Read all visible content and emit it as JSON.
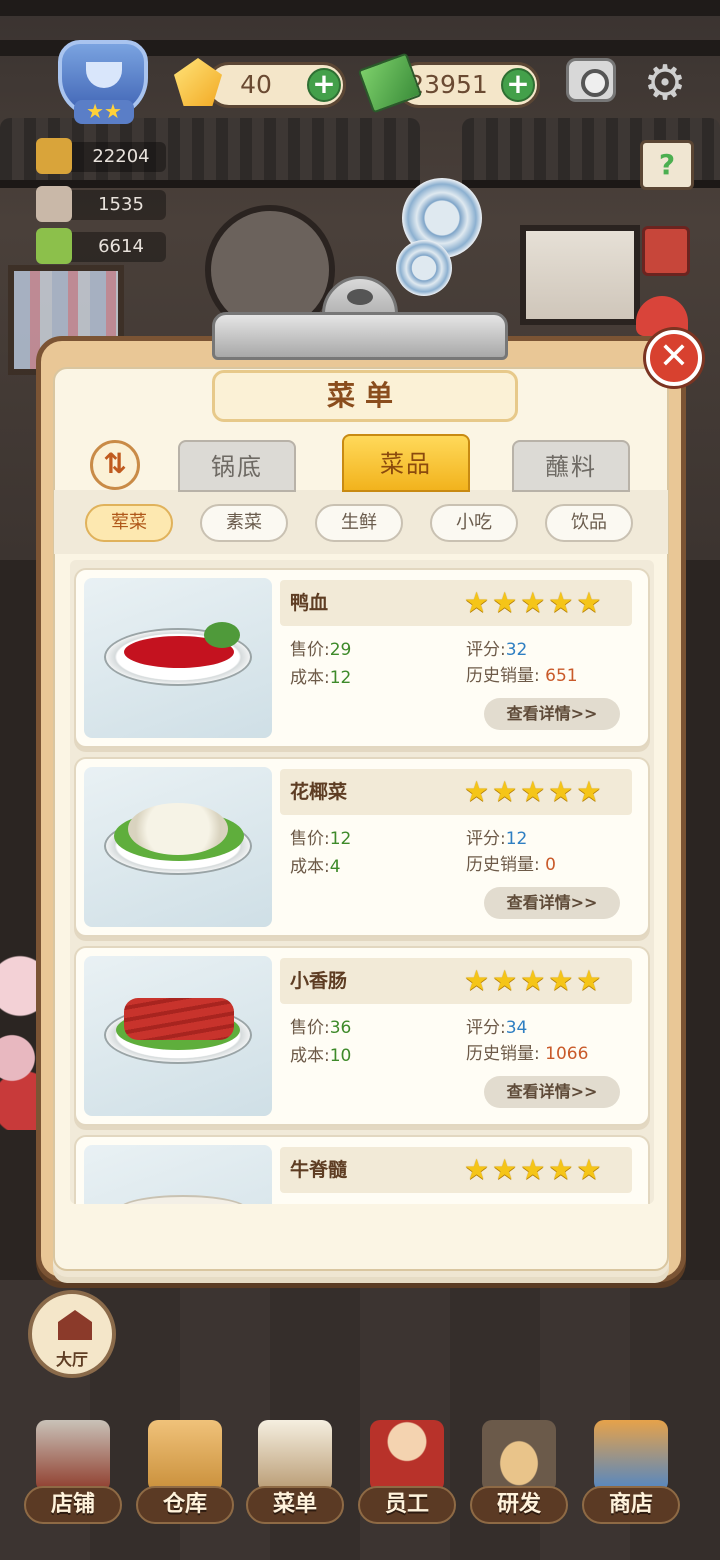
{
  "hud": {
    "gems": "40",
    "cash": "23951",
    "stat_pot": "22204",
    "stat_dish": "1535",
    "stat_ticket": "6614",
    "level_stars": "★★"
  },
  "menu": {
    "title": "菜单",
    "sort_icon": "⇅",
    "tabs": [
      "锅底",
      "菜品",
      "蘸料"
    ],
    "active_tab": 1,
    "categories": [
      "荤菜",
      "素菜",
      "生鲜",
      "小吃",
      "饮品"
    ],
    "active_category": 0,
    "labels": {
      "price": "售价:",
      "cost": "成本:",
      "rating": "评分:",
      "sales": "历史销量:",
      "detail": "查看详情>>"
    },
    "dishes": [
      {
        "name": "鸭血",
        "stars": 5,
        "price": "29",
        "cost": "12",
        "rating": "32",
        "sales": "651",
        "food": "duck-blood"
      },
      {
        "name": "花椰菜",
        "stars": 5,
        "price": "12",
        "cost": "4",
        "rating": "12",
        "sales": "0",
        "food": "cauliflower"
      },
      {
        "name": "小香肠",
        "stars": 5,
        "price": "36",
        "cost": "10",
        "rating": "34",
        "sales": "1066",
        "food": "sausage"
      },
      {
        "name": "牛脊髓",
        "stars": 5,
        "food": "beef-marrow"
      }
    ]
  },
  "hall_label": "大厅",
  "nav": [
    "店铺",
    "仓库",
    "菜单",
    "员工",
    "研发",
    "商店"
  ],
  "icons": {
    "close": "✕",
    "plus": "+",
    "gear": "⚙",
    "help": "?"
  },
  "colors": {
    "accent": "#f2b31d",
    "price_green": "#3e8a2a",
    "rating_blue": "#2f7fc2",
    "sales_red": "#c95a2a",
    "close_red": "#d8412f"
  }
}
